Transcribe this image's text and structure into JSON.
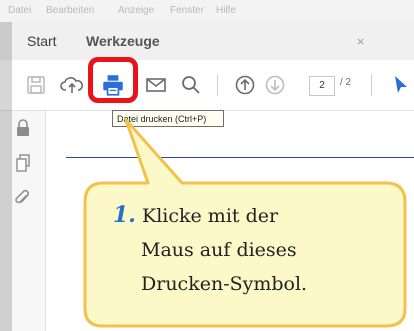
{
  "menu": [
    "Datei",
    "Bearbeiten",
    "Anzeige",
    "Fenster",
    "Hilfe"
  ],
  "tabs": {
    "start": "Start",
    "tools": "Werkzeuge",
    "close": "×"
  },
  "toolbar": {
    "page_current": "2",
    "page_total": "/ 2"
  },
  "tooltip": "Datei drucken (Ctrl+P)",
  "callout": {
    "number": "1.",
    "line1": "Klicke mit der",
    "line2": "Maus auf dieses",
    "line3": "Drucken-Symbol."
  },
  "colors": {
    "highlight": "#e8141a",
    "bubble_fill": "#fdf8c7",
    "bubble_border": "#f2c14e",
    "number": "#1f73c9",
    "accent_blue": "#2b6fd6"
  }
}
